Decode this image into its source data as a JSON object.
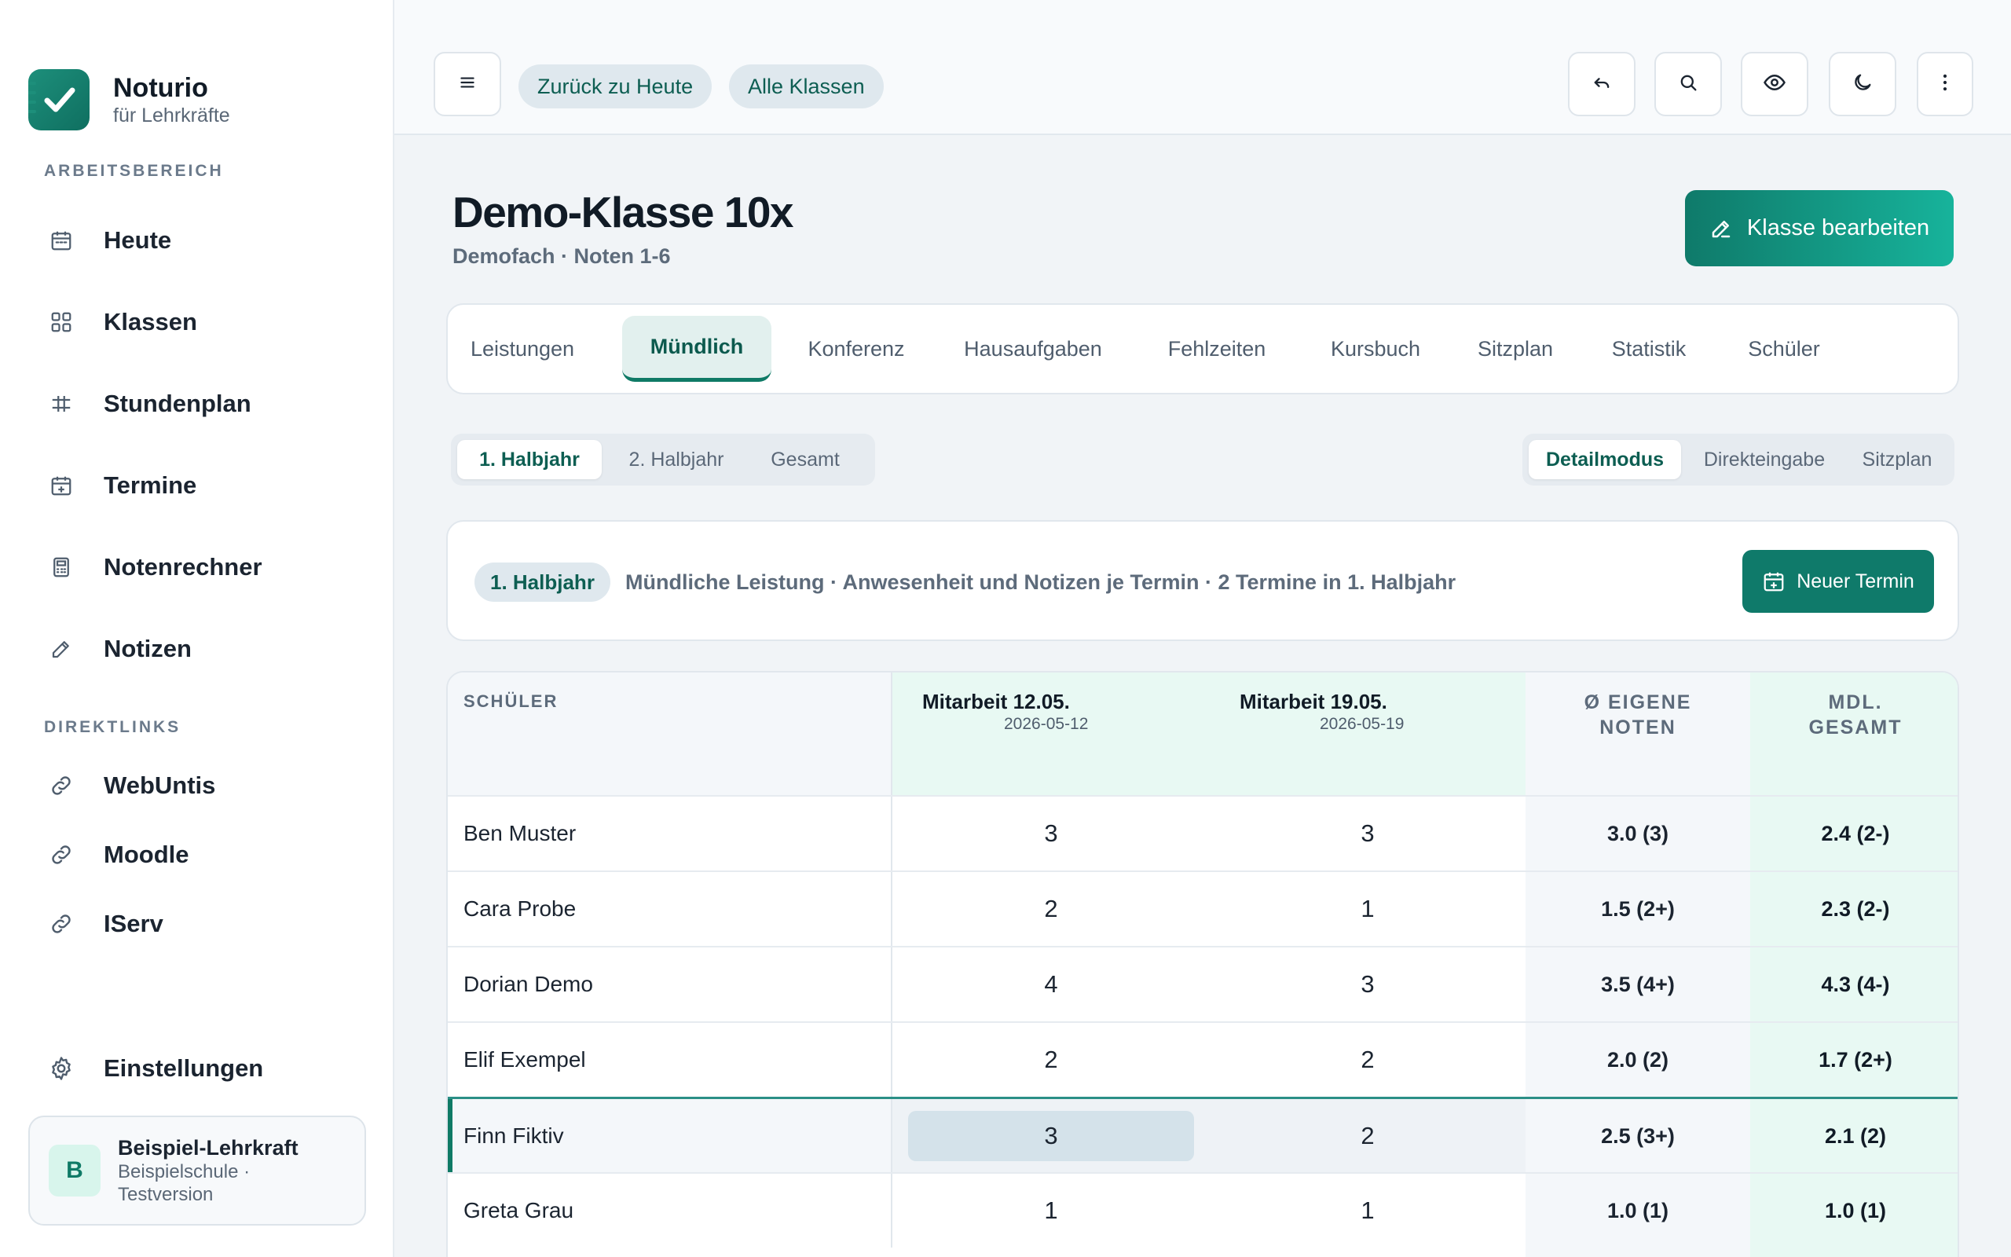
{
  "app": {
    "name": "Noturio",
    "subtitle": "für Lehrkräfte"
  },
  "sidebar": {
    "workspace_label": "ARBEITSBEREICH",
    "items": [
      {
        "label": "Heute",
        "icon": "calendar-icon"
      },
      {
        "label": "Klassen",
        "icon": "grid-icon"
      },
      {
        "label": "Stundenplan",
        "icon": "timetable-icon"
      },
      {
        "label": "Termine",
        "icon": "calendar-plus-icon"
      },
      {
        "label": "Notenrechner",
        "icon": "calculator-icon"
      },
      {
        "label": "Notizen",
        "icon": "pen-icon"
      }
    ],
    "links_label": "DIREKTLINKS",
    "links": [
      {
        "label": "WebUntis",
        "icon": "link-icon"
      },
      {
        "label": "Moodle",
        "icon": "link-icon"
      },
      {
        "label": "IServ",
        "icon": "link-icon"
      }
    ],
    "settings_label": "Einstellungen",
    "user": {
      "initial": "B",
      "name": "Beispiel-Lehrkraft",
      "org_line1": "Beispielschule ·",
      "org_line2": "Testversion"
    }
  },
  "topbar": {
    "back_today": "Zurück zu Heute",
    "all_classes": "Alle Klassen",
    "icons": [
      "menu-icon",
      "undo-icon",
      "search-icon",
      "eye-icon",
      "moon-icon",
      "more-vertical-icon"
    ]
  },
  "page": {
    "title": "Demo-Klasse 10x",
    "subtitle": "Demofach · Noten 1-6",
    "edit_button": "Klasse bearbeiten"
  },
  "tabs": [
    "Leistungen",
    "Mündlich",
    "Konferenz",
    "Hausaufgaben",
    "Fehlzeiten",
    "Kursbuch",
    "Sitzplan",
    "Statistik",
    "Schüler"
  ],
  "active_tab": "Mündlich",
  "term_switch": {
    "items": [
      "1. Halbjahr",
      "2. Halbjahr",
      "Gesamt"
    ],
    "active": "1. Halbjahr"
  },
  "mode_switch": {
    "items": [
      "Detailmodus",
      "Direkteingabe",
      "Sitzplan"
    ],
    "active": "Detailmodus"
  },
  "info": {
    "badge": "1. Halbjahr",
    "text": "Mündliche Leistung · Anwesenheit und Notizen je Termin · 2 Termine in 1. Halbjahr",
    "new_button": "Neuer Termin"
  },
  "table": {
    "col_student": "SCHÜLER",
    "terms": [
      {
        "title": "Mitarbeit 12.05.",
        "date": "2026-05-12"
      },
      {
        "title": "Mitarbeit 19.05.",
        "date": "2026-05-19"
      }
    ],
    "col_avg_line1": "Ø EIGENE",
    "col_avg_line2": "NOTEN",
    "col_total_line1": "MDL.",
    "col_total_line2": "GESAMT",
    "rows": [
      {
        "name": "Ben Muster",
        "g1": "3",
        "g2": "3",
        "avg": "3.0 (3)",
        "total": "2.4 (2-)"
      },
      {
        "name": "Cara Probe",
        "g1": "2",
        "g2": "1",
        "avg": "1.5 (2+)",
        "total": "2.3 (2-)"
      },
      {
        "name": "Dorian Demo",
        "g1": "4",
        "g2": "3",
        "avg": "3.5 (4+)",
        "total": "4.3 (4-)"
      },
      {
        "name": "Elif Exempel",
        "g1": "2",
        "g2": "2",
        "avg": "2.0 (2)",
        "total": "1.7 (2+)"
      },
      {
        "name": "Finn Fiktiv",
        "g1": "3",
        "g2": "2",
        "avg": "2.5 (3+)",
        "total": "2.1 (2)"
      },
      {
        "name": "Greta Grau",
        "g1": "1",
        "g2": "1",
        "avg": "1.0 (1)",
        "total": "1.0 (1)"
      }
    ],
    "selected_row": "Finn Fiktiv"
  },
  "colors": {
    "accent": "#0f7a6a",
    "accent_light": "#17b39b",
    "term_column_bg": "#e8f9f3",
    "pill_bg": "#dfe8ee"
  }
}
